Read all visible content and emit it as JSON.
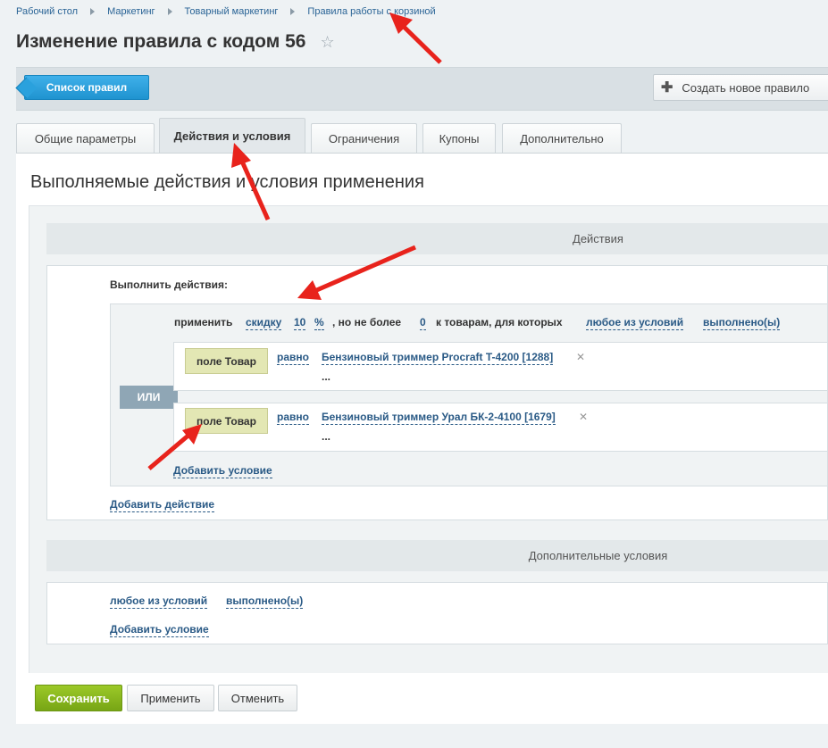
{
  "breadcrumb": [
    "Рабочий стол",
    "Маркетинг",
    "Товарный маркетинг",
    "Правила работы с корзиной"
  ],
  "page_title": "Изменение правила с кодом 56",
  "toolbar": {
    "list_label": "Список правил",
    "create_label": "Создать новое правило"
  },
  "tabs": [
    "Общие параметры",
    "Действия и условия",
    "Ограничения",
    "Купоны",
    "Дополнительно"
  ],
  "active_tab": "Действия и условия",
  "section_title": "Выполняемые действия и условия применения",
  "actions": {
    "header": "Действия",
    "run_label": "Выполнить действия:",
    "apply": {
      "apply_word": "применить",
      "type": "скидку",
      "amount": "10",
      "unit": "%",
      "not_more_text": ", но не более",
      "max": "0",
      "for_goods_text": "к товарам, для которых",
      "any_link": "любое из условий",
      "fulfilled_link": "выполнено(ы)"
    },
    "logic": "ИЛИ",
    "conditions": [
      {
        "field": "поле Товар",
        "operator": "равно",
        "value": "Бензиновый триммер Procraft T-4200 [1288]",
        "more": "..."
      },
      {
        "field": "поле Товар",
        "operator": "равно",
        "value": "Бензиновый триммер Урал БК-2-4100 [1679]",
        "more": "..."
      }
    ],
    "add_condition": "Добавить условие",
    "add_action": "Добавить действие"
  },
  "extra": {
    "header": "Дополнительные условия",
    "any_link": "любое из условий",
    "fulfilled_link": "выполнено(ы)",
    "add_condition": "Добавить условие"
  },
  "buttons": {
    "save": "Сохранить",
    "apply": "Применить",
    "cancel": "Отменить"
  },
  "colors": {
    "accent_blue": "#1f93d0",
    "save_green": "#77a515",
    "field_bg": "#e3e7b4",
    "arrow_red": "#e8231c"
  }
}
